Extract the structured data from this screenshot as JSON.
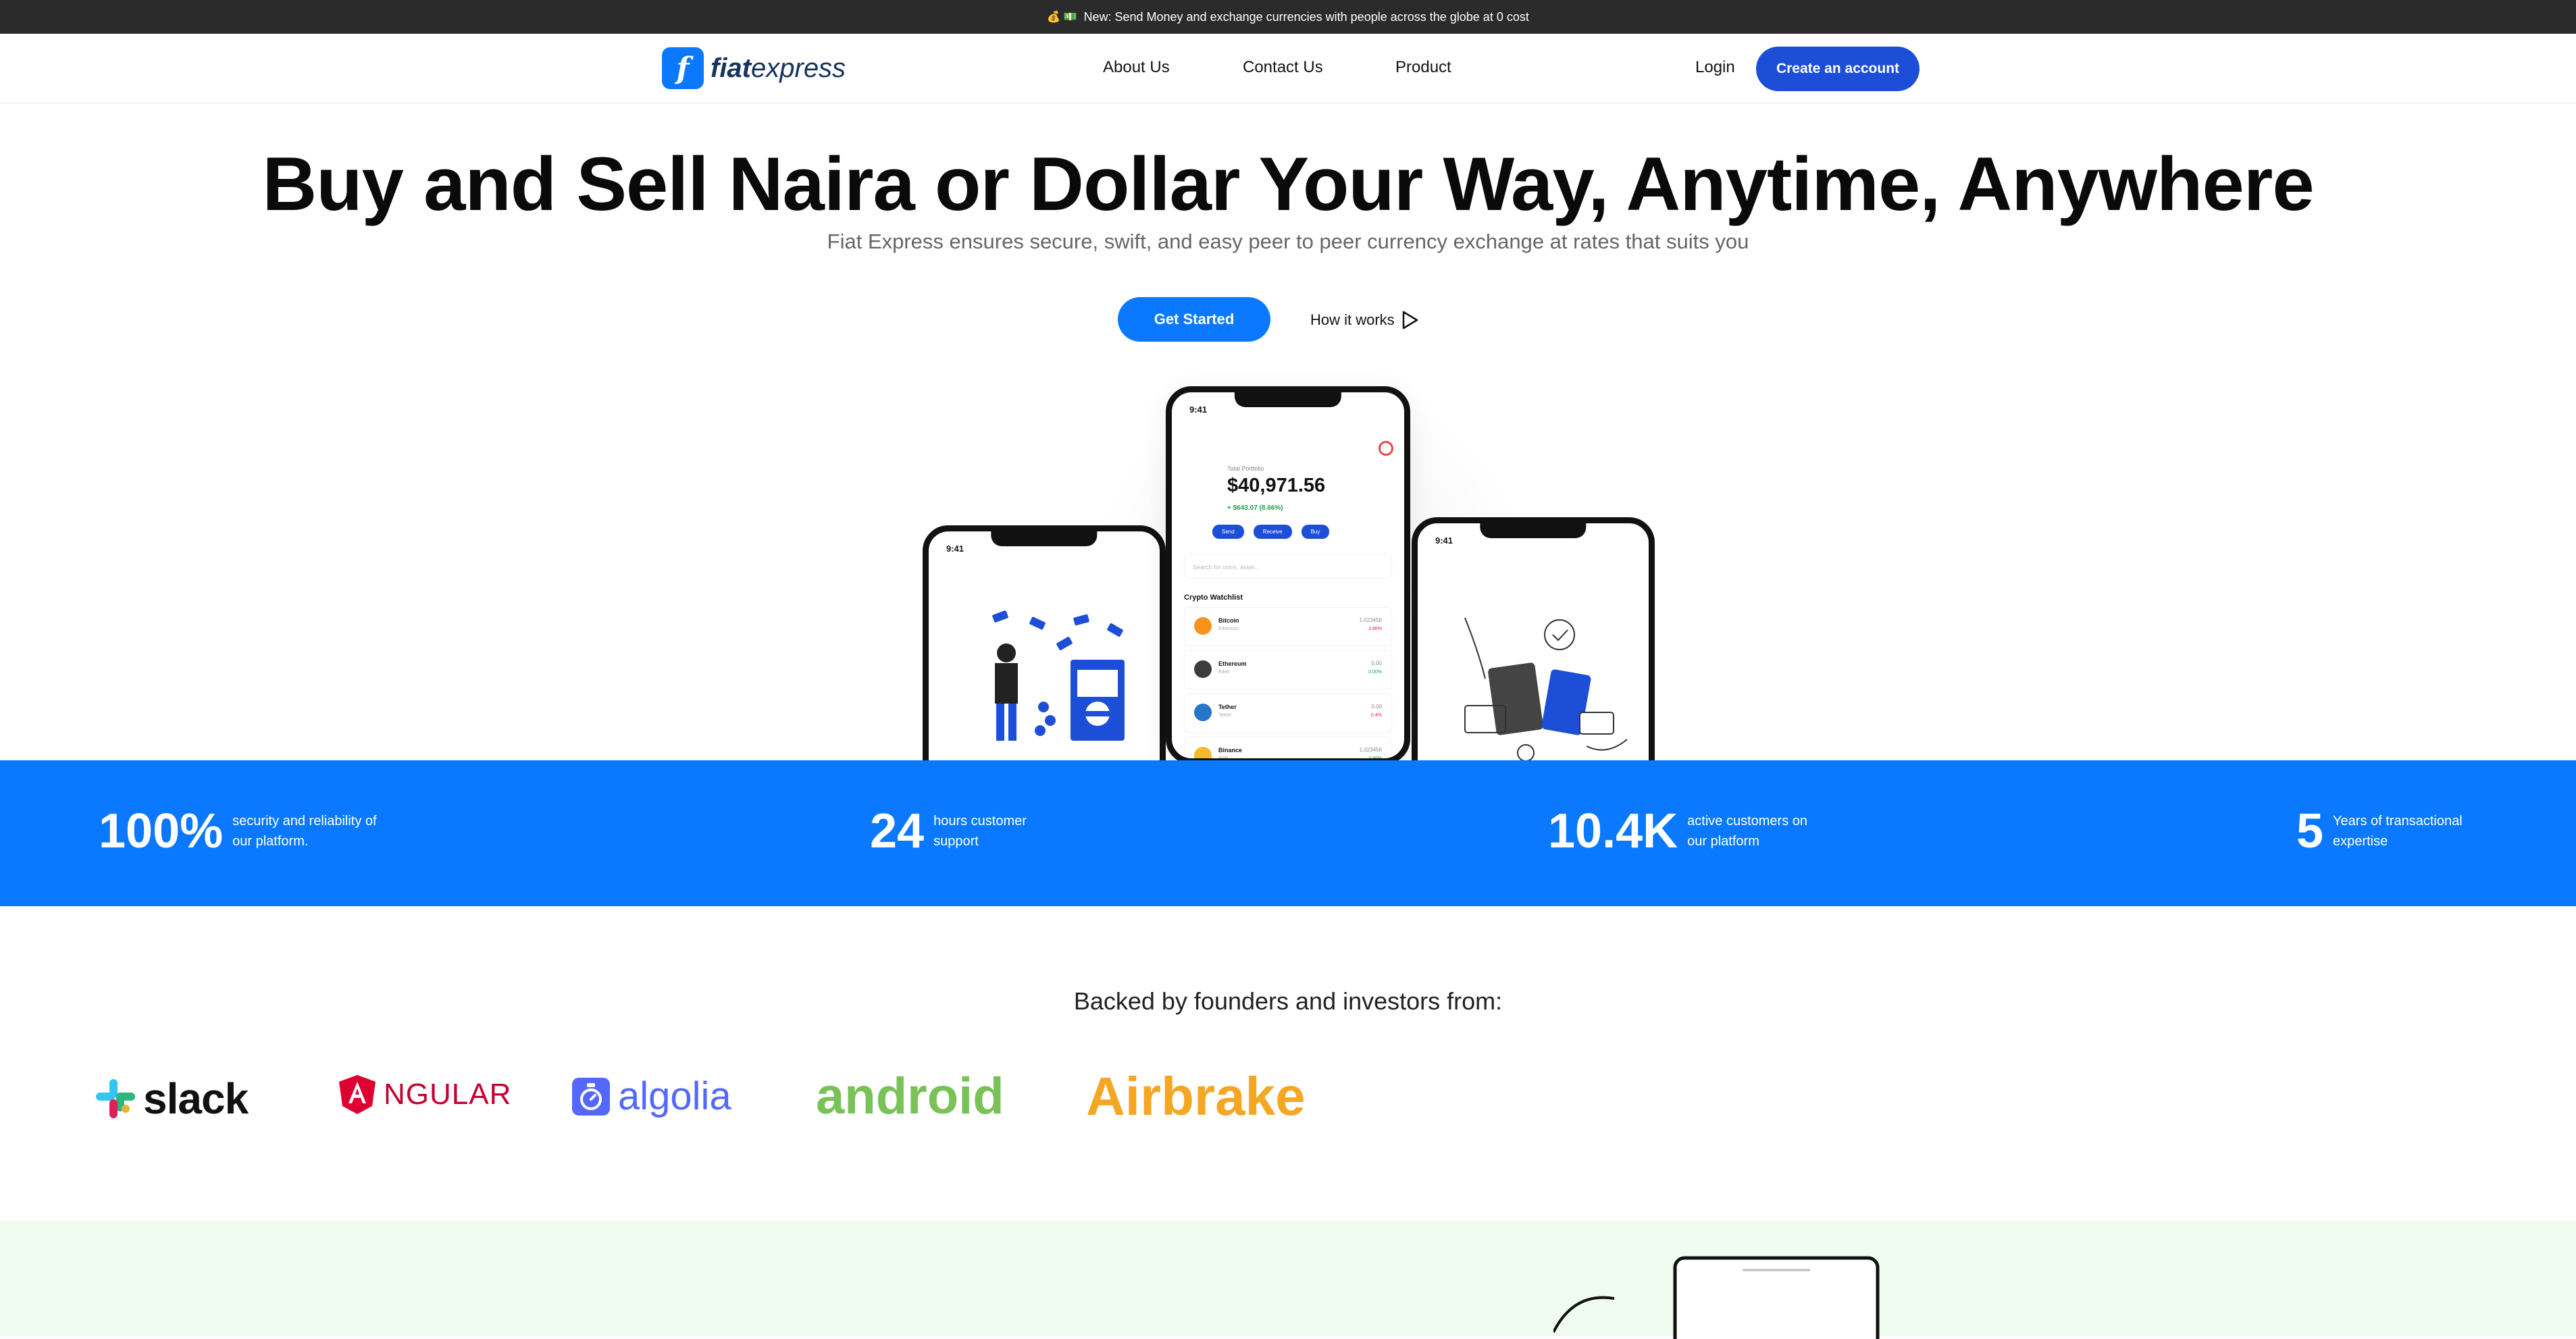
{
  "announcement": {
    "emoji": "💰 💵",
    "text": "New: Send Money and exchange currencies with people across the globe at 0 cost"
  },
  "nav": {
    "logo_bold": "fiat",
    "logo_light": "express",
    "links": [
      "About Us",
      "Contact Us",
      "Product"
    ],
    "login": "Login",
    "cta": "Create an account"
  },
  "hero": {
    "title": "Buy and Sell Naira or Dollar Your Way, Anytime, Anywhere",
    "subtitle": "Fiat Express ensures secure, swift, and easy peer to peer currency exchange at rates that suits you",
    "primary_button": "Get Started",
    "secondary_button": "How it works"
  },
  "phone_center": {
    "time": "9:41",
    "portfolio_label": "Total Portfolio",
    "portfolio_value": "$40,971.56",
    "portfolio_change": "+ $643.07 (8.66%)",
    "actions": [
      "Send",
      "Receive",
      "Buy"
    ],
    "search_placeholder": "Search for coins, asset...",
    "watchlist_title": "Crypto Watchlist",
    "watchlist": [
      {
        "name": "Bitcoin",
        "ticker": "BTC",
        "sub": "Ethereum",
        "value": "1.023456",
        "change": "3.86%",
        "color": "#f7931a",
        "up": false
      },
      {
        "name": "Ethereum",
        "ticker": "ETH",
        "sub": "Ether",
        "value": "0.00",
        "change": "0.00%",
        "color": "#3c3c3d",
        "up": true
      },
      {
        "name": "Tether",
        "ticker": "USDT",
        "sub": "Tether",
        "value": "0.00",
        "change": "0.4%",
        "color": "#2775ca",
        "up": false
      },
      {
        "name": "Binance",
        "ticker": "BNB",
        "sub": "BNB",
        "value": "1.023456",
        "change": "3.86%",
        "color": "#f3ba2f",
        "up": true
      }
    ]
  },
  "phone_left": {
    "time": "9:41"
  },
  "phone_right": {
    "time": "9:41"
  },
  "stats": [
    {
      "number": "100%",
      "desc": "security and reliability of our platform."
    },
    {
      "number": "24",
      "desc": "hours customer support"
    },
    {
      "number": "10.4K",
      "desc": "active customers on our platform"
    },
    {
      "number": "5",
      "desc": "Years of transactional expertise"
    }
  ],
  "backers": {
    "heading": "Backed by founders and investors from:",
    "brands": [
      "slack",
      "NGULAR",
      "algolia",
      "android",
      "Airbrake"
    ]
  },
  "colors": {
    "primary": "#0a79ff",
    "cta": "#1d4ed8",
    "dark_bar": "#2b2b2b",
    "bottom_bg": "#eefbee"
  }
}
